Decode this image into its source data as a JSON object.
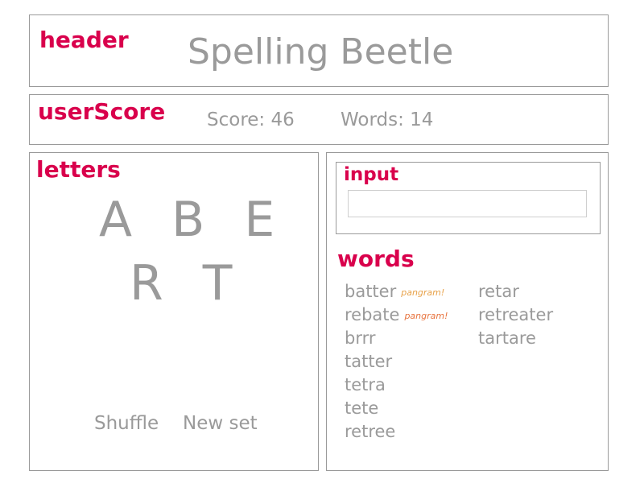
{
  "header": {
    "label": "header",
    "title": "Spelling Beetle"
  },
  "userScore": {
    "label": "userScore",
    "score_text": "Score: 46",
    "words_text": "Words: 14"
  },
  "letters": {
    "label": "letters",
    "row1": [
      "A",
      "B",
      "E"
    ],
    "row2": [
      "R",
      "T"
    ],
    "shuffle_label": "Shuffle",
    "new_set_label": "New set"
  },
  "input": {
    "label": "input",
    "value": "",
    "placeholder": ""
  },
  "words": {
    "label": "words",
    "columns": [
      [
        {
          "word": "batter",
          "tag": "pangram!",
          "tag_color": "#e8a24a"
        },
        {
          "word": "rebate",
          "tag": "pangram!",
          "tag_color": "#e8743f"
        },
        {
          "word": "brrr",
          "tag": ""
        },
        {
          "word": "tatter",
          "tag": ""
        },
        {
          "word": "tetra",
          "tag": ""
        },
        {
          "word": "tete",
          "tag": ""
        },
        {
          "word": "retree",
          "tag": ""
        }
      ],
      [
        {
          "word": "retar",
          "tag": ""
        },
        {
          "word": "retreater",
          "tag": ""
        },
        {
          "word": "tartare",
          "tag": ""
        }
      ]
    ]
  },
  "colors": {
    "label_color": "#d9004c",
    "text_color": "#9a9a9a",
    "border_color": "#9a9a9a"
  }
}
